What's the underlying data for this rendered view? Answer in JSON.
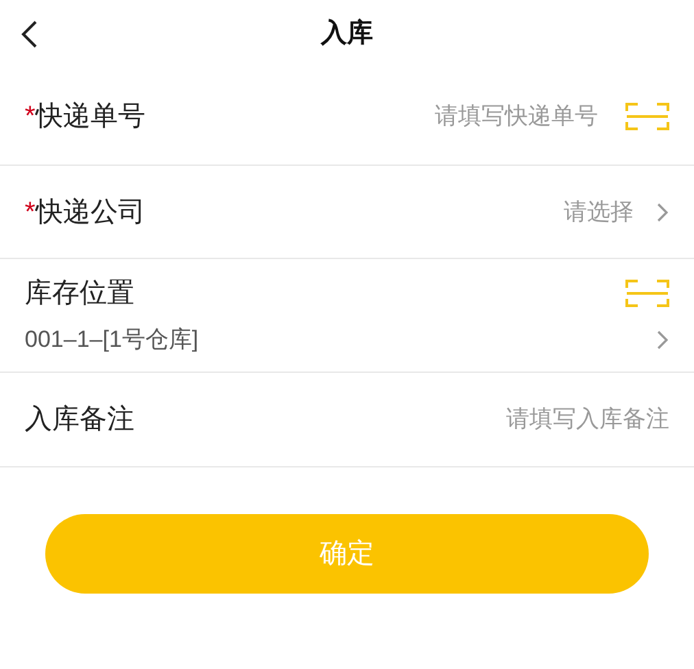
{
  "header": {
    "title": "入库"
  },
  "rows": [
    {
      "kind": "input",
      "marker": "*",
      "label": "快递单号",
      "placeholder": "请填写快递单号"
    },
    {
      "kind": "select",
      "marker": "*",
      "label": "快递公司",
      "placeholder": "请选择"
    },
    {
      "kind": "location",
      "label": "库存位置",
      "value": "001–1–[1号仓库]"
    },
    {
      "kind": "note",
      "label": "入库备注",
      "placeholder": "请填写入库备注"
    }
  ],
  "button": {
    "label": "确定"
  }
}
